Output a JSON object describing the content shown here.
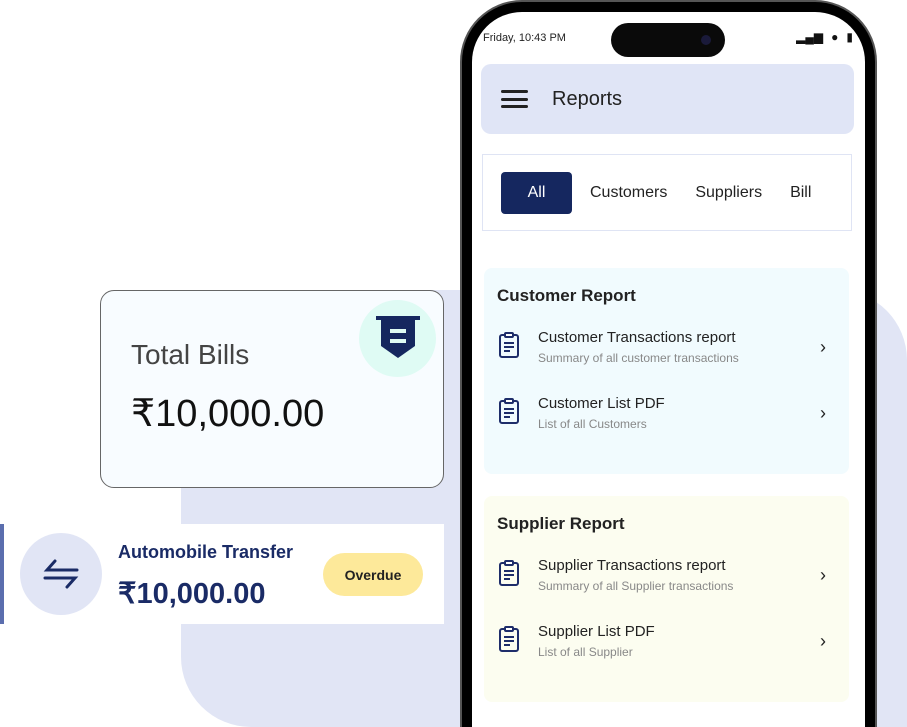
{
  "status": {
    "time": "Friday, 10:43 PM"
  },
  "header": {
    "title": "Reports"
  },
  "tabs": [
    {
      "label": "All"
    },
    {
      "label": "Customers"
    },
    {
      "label": "Suppliers"
    },
    {
      "label": "Bill"
    }
  ],
  "sections": [
    {
      "title": "Customer Report",
      "items": [
        {
          "title": "Customer Transactions report",
          "subtitle": "Summary of all customer transactions"
        },
        {
          "title": "Customer List PDF",
          "subtitle": "List of all Customers"
        }
      ]
    },
    {
      "title": "Supplier Report",
      "items": [
        {
          "title": "Supplier Transactions report",
          "subtitle": "Summary of all Supplier transactions"
        },
        {
          "title": "Supplier List PDF",
          "subtitle": "List of all Supplier"
        }
      ]
    }
  ],
  "total_card": {
    "label": "Total Bills",
    "amount": "₹10,000.00"
  },
  "transaction": {
    "name": "Automobile Transfer",
    "amount": "₹10,000.00",
    "status": "Overdue"
  },
  "colors": {
    "primary": "#15275f",
    "lavender": "#e1e5f5",
    "overdue": "#fde99a"
  }
}
